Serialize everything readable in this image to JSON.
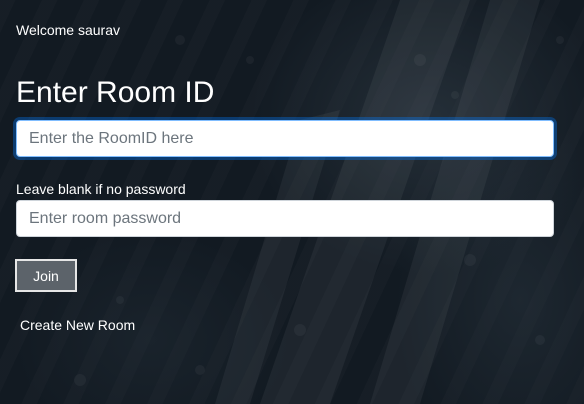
{
  "welcome_text": "Welcome saurav",
  "form": {
    "heading": "Enter Room ID",
    "room_id": {
      "value": "",
      "placeholder": "Enter the RoomID here"
    },
    "password_label": "Leave blank if no password",
    "password": {
      "value": "",
      "placeholder": "Enter room password"
    },
    "join_label": "Join"
  },
  "create_room_label": "Create New Room",
  "colors": {
    "background": "#121a22",
    "text": "#ffffff",
    "focus_border": "#80bdff",
    "join_button": "#5c636a"
  }
}
